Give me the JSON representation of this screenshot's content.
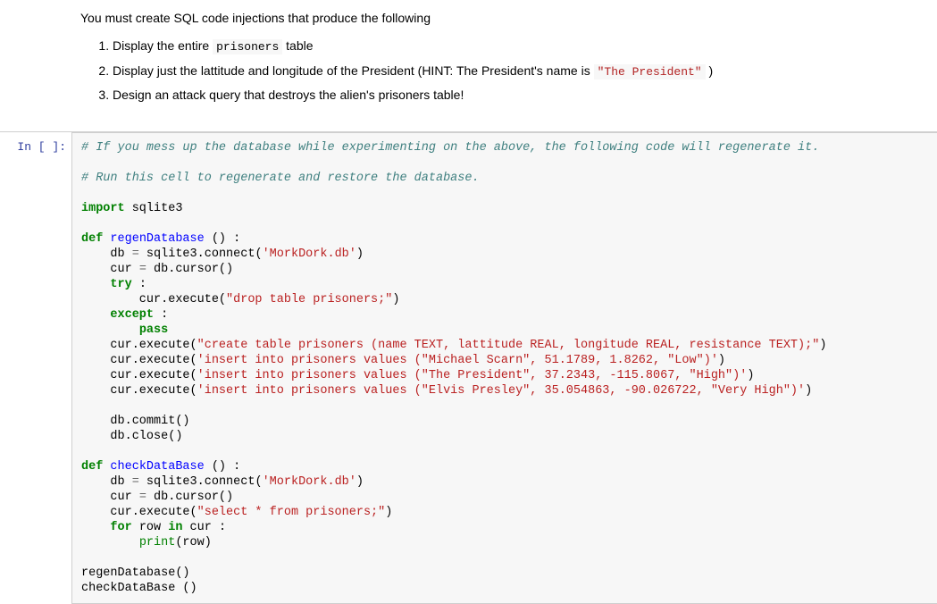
{
  "markdown": {
    "intro": "You must create SQL code injections that produce the following",
    "items": [
      {
        "pre": "Display the entire ",
        "code": "prisoners",
        "post": " table"
      },
      {
        "pre": "Display just the lattitude and longitude of the President (HINT: The President's name is ",
        "code": "\"The President\"",
        "post": " )"
      },
      {
        "pre": "Design an attack query that destroys the alien's prisoners table!",
        "code": "",
        "post": ""
      }
    ]
  },
  "prompt": {
    "label": "In [ ]:"
  },
  "code": {
    "comment1": "# If you mess up the database while experimenting on the above, the following code will regenerate it.",
    "comment2": "# Run this cell to regenerate and restore the database.",
    "kw_import": "import",
    "mod_sqlite": " sqlite3",
    "kw_def": "def",
    "fn_regen": " regenDatabase",
    "fn_regen_sig": " () :",
    "ln_db_connect_a": "    db ",
    "op_eq": "=",
    "ln_db_connect_b": " sqlite3.connect(",
    "str_dbfile": "'MorkDork.db'",
    "ln_db_connect_c": ")",
    "ln_cur_a": "    cur ",
    "ln_cur_b": " db.cursor()",
    "kw_try": "try",
    "ln_try_sig": " :",
    "ln_exec_a": "        cur.execute(",
    "str_drop": "\"drop table prisoners;\"",
    "ln_exec_b": ")",
    "kw_except": "except",
    "ln_except_sig": " :",
    "kw_pass": "pass",
    "ln_exec2_a": "    cur.execute(",
    "str_create": "\"create table prisoners (name TEXT, lattitude REAL, longitude REAL, resistance TEXT);\"",
    "str_ins1": "'insert into prisoners values (\"Michael Scarn\", 51.1789, 1.8262, \"Low\")'",
    "str_ins2": "'insert into prisoners values (\"The President\", 37.2343, -115.8067, \"High\")'",
    "str_ins3": "'insert into prisoners values (\"Elvis Presley\", 35.054863, -90.026722, \"Very High\")'",
    "ln_commit": "    db.commit()",
    "ln_close": "    db.close()",
    "fn_check": " checkDataBase",
    "fn_check_sig": " () :",
    "str_select": "\"select * from prisoners;\"",
    "kw_for": "for",
    "ln_for_a": " row ",
    "kw_in": "in",
    "ln_for_b": " cur :",
    "ln_print_a": "        ",
    "builtin_print": "print",
    "ln_print_b": "(row)",
    "ln_call_regen": "regenDatabase()",
    "ln_call_check": "checkDataBase ()",
    "indent4": "    ",
    "indent8": "        "
  },
  "chart_data": {
    "type": "table",
    "title": "prisoners",
    "columns": [
      "name",
      "lattitude",
      "longitude",
      "resistance"
    ],
    "rows": [
      [
        "Michael Scarn",
        51.1789,
        1.8262,
        "Low"
      ],
      [
        "The President",
        37.2343,
        -115.8067,
        "High"
      ],
      [
        "Elvis Presley",
        35.054863,
        -90.026722,
        "Very High"
      ]
    ]
  }
}
